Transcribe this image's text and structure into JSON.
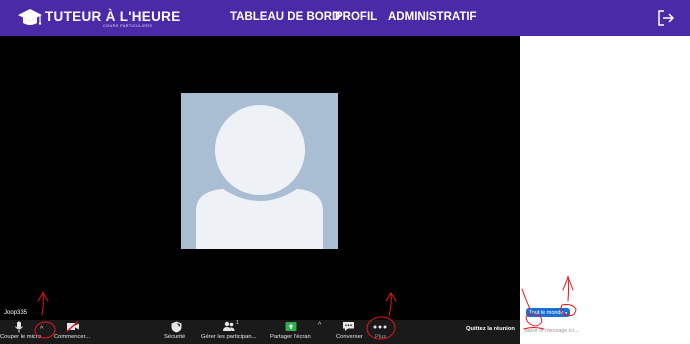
{
  "header": {
    "logo_title": "TUTEUR À L'HEURE",
    "logo_subtitle": "COURS PARTICULIERS",
    "nav": [
      "TABLEAU DE BORD",
      "PROFIL",
      "ADMINISTRATIF"
    ]
  },
  "meeting": {
    "participant_name": "Joop335"
  },
  "toolbar": {
    "mute_label": "Couper le micro",
    "video_label": "Commencer...",
    "security_label": "Sécurité",
    "participants_label": "Gérer les participan...",
    "participants_count": "1",
    "share_label": "Partager l'écran",
    "chat_label": "Converser",
    "more_label": "Plus",
    "quit_label": "Quittez la réunion"
  },
  "chat": {
    "recipient": "Tout le monde",
    "input_placeholder": "Saisir le message ici..."
  },
  "colors": {
    "header_bg": "#4a2aa6",
    "avatar_bg": "#a9bdd3",
    "avatar_fg": "#eef2f7",
    "share_green": "#2eb04f",
    "recipient_blue": "#1a6fd6",
    "annotation_red": "#e8141c"
  }
}
